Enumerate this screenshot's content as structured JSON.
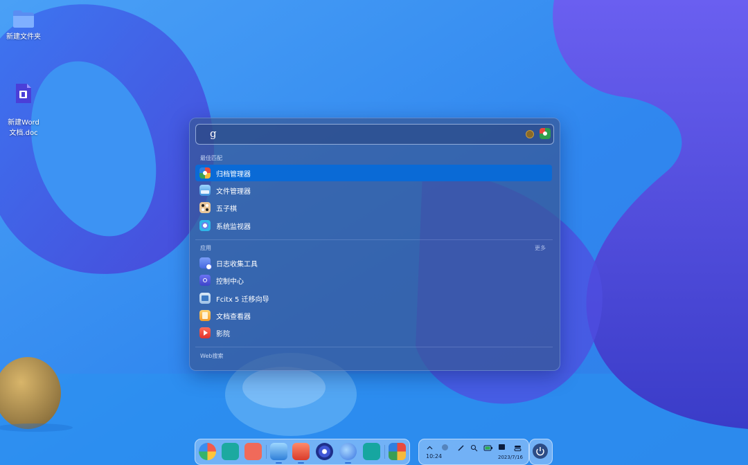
{
  "desktop": {
    "icons": [
      {
        "label": "新建文件夹",
        "icon": "folder-icon"
      },
      {
        "label": "新建Word\n文档.doc",
        "icon": "word-document-icon"
      }
    ]
  },
  "launcher": {
    "search": {
      "value": "g"
    },
    "best_match": {
      "title": "最佳匹配",
      "items": [
        {
          "label": "归档管理器",
          "icon": "archive-manager-icon",
          "active": true
        },
        {
          "label": "文件管理器",
          "icon": "file-manager-icon"
        },
        {
          "label": "五子棋",
          "icon": "gomoku-icon"
        },
        {
          "label": "系统监视器",
          "icon": "system-monitor-icon"
        }
      ]
    },
    "apps": {
      "title": "应用",
      "more": "更多",
      "items": [
        {
          "label": "日志收集工具",
          "icon": "log-collector-icon"
        },
        {
          "label": "控制中心",
          "icon": "control-center-icon"
        },
        {
          "label": "Fcitx 5 迁移向导",
          "icon": "fcitx-migrator-icon"
        },
        {
          "label": "文档查看器",
          "icon": "document-viewer-icon"
        },
        {
          "label": "影院",
          "icon": "movie-icon"
        }
      ]
    },
    "web_search": {
      "title": "Web搜索"
    }
  },
  "dock": {
    "apps": [
      "launcher-icon",
      "multitask-view-icon",
      "app-store-icon",
      "file-manager-icon",
      "mail-icon",
      "control-center-icon",
      "browser-icon",
      "terminal-icon",
      "archive-manager-icon"
    ],
    "tray": {
      "time": "10:24",
      "date": "2023/7/16"
    }
  },
  "colors": {
    "accent": "#0a6ad6",
    "launcher_bg": "#385896",
    "wallpaper": "#3a8cf2"
  }
}
